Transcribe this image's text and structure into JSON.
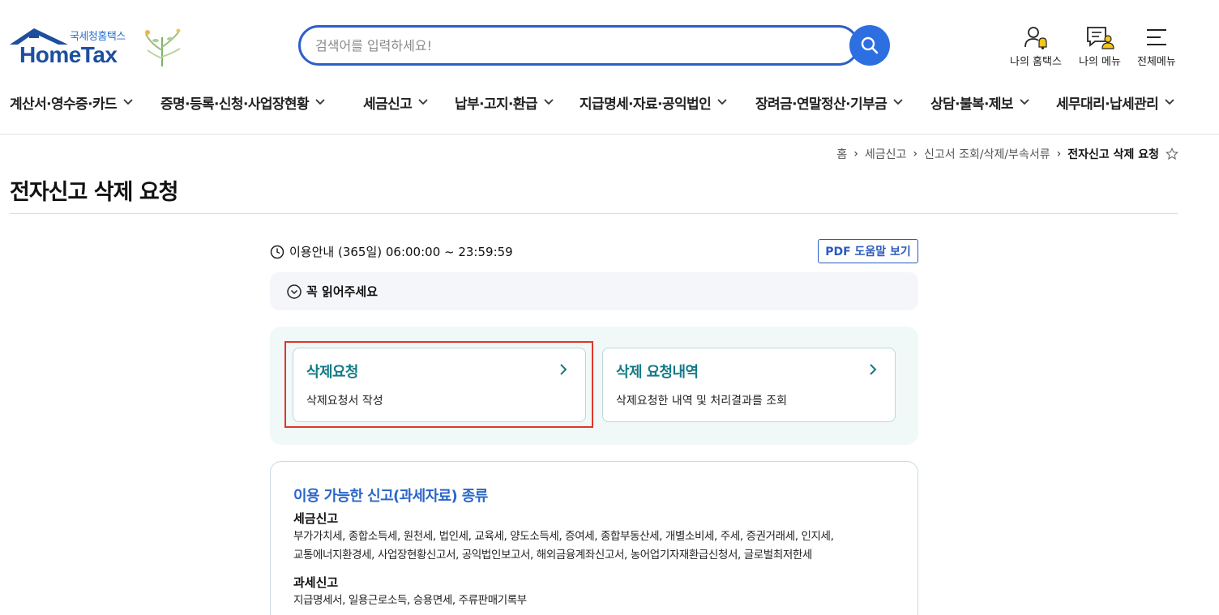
{
  "header": {
    "logo_sub": "국세청홈택스",
    "logo_main": "HomeTax",
    "search_placeholder": "검색어를 입력하세요!",
    "util": {
      "my_hometax": "나의 홈택스",
      "my_menu": "나의 메뉴",
      "all_menu": "전체메뉴"
    }
  },
  "gnb": [
    "계산서·영수증·카드",
    "증명·등록·신청·사업장현황",
    "세금신고",
    "납부·고지·환급",
    "지급명세·자료·공익법인",
    "장려금·연말정산·기부금",
    "상담·불복·제보",
    "세무대리·납세관리"
  ],
  "breadcrumb": [
    "홈",
    "세금신고",
    "신고서 조회/삭제/부속서류",
    "전자신고 삭제 요청"
  ],
  "page_title": "전자신고 삭제 요청",
  "usage": "이용안내 (365일) 06:00:00 ~ 23:59:59",
  "pdf_button": "PDF 도움말 보기",
  "notice": "꼭 읽어주세요",
  "cards": [
    {
      "title": "삭제요청",
      "desc": "삭제요청서 작성"
    },
    {
      "title": "삭제 요청내역",
      "desc": "삭제요청한 내역 및 처리결과를 조회"
    }
  ],
  "info": {
    "title": "이용 가능한 신고(과세자료) 종류",
    "sections": [
      {
        "heading": "세금신고",
        "lines": [
          "부가가치세, 종합소득세, 원천세, 법인세, 교육세, 양도소득세, 증여세, 종합부동산세, 개별소비세, 주세, 증권거래세, 인지세,",
          "교통에너지환경세, 사업장현황신고서, 공익법인보고서, 해외금융계좌신고서, 농어업기자재환급신청서, 글로벌최저한세"
        ]
      },
      {
        "heading": "과세신고",
        "lines": [
          "지급명세서, 일용근로소득, 승용면세, 주류판매기록부"
        ]
      }
    ]
  },
  "colors": {
    "brand_blue": "#2d6fe0",
    "card_title": "#137a86",
    "highlight_red": "#e0352b"
  }
}
